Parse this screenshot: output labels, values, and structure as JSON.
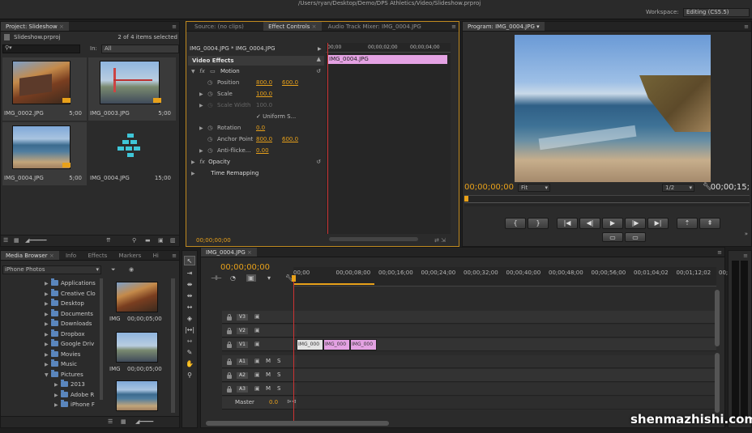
{
  "menubar": {
    "title": "/Users/ryan/Desktop/Demo/DPS Athletics/Video/Slideshow.prproj",
    "workspace_label": "Workspace:",
    "workspace_value": "Editing (CS5.5)"
  },
  "project": {
    "tab": "Project: Slideshow",
    "file": "Slideshow.prproj",
    "count": "2 of 4 items selected",
    "search_placeholder": "",
    "in_label": "In:",
    "in_value": "All",
    "items": [
      {
        "name": "IMG_0002.JPG",
        "duration": "5;00"
      },
      {
        "name": "IMG_0003.JPG",
        "duration": "5;00"
      },
      {
        "name": "IMG_0004.JPG",
        "duration": "5;00"
      },
      {
        "name": "IMG_0004.JPG",
        "duration": "15;00"
      }
    ]
  },
  "effects": {
    "tabs": [
      "Source: (no clips)",
      "Effect Controls",
      "Audio Track Mixer: IMG_0004.JPG"
    ],
    "clip_path": "IMG_0004.JPG * IMG_0004.JPG",
    "section": "Video Effects",
    "motion": "Motion",
    "props": [
      {
        "name": "Position",
        "v1": "800.0",
        "v2": "600.0"
      },
      {
        "name": "Scale",
        "v1": "100.0",
        "v2": ""
      },
      {
        "name": "Scale Width",
        "v1": "100.0",
        "v2": ""
      },
      {
        "name": "Uniform S...",
        "v1": "",
        "v2": ""
      },
      {
        "name": "Rotation",
        "v1": "0.0",
        "v2": ""
      },
      {
        "name": "Anchor Point",
        "v1": "800.0",
        "v2": "600.0"
      },
      {
        "name": "Anti-flicke...",
        "v1": "0.00",
        "v2": ""
      }
    ],
    "opacity": "Opacity",
    "time_remap": "Time Remapping",
    "ruler": [
      "00;00",
      "00;00;02;00",
      "00;00;04;00"
    ],
    "clip_label": "IMG_0004.JPG",
    "timecode": "00;00;00;00"
  },
  "program": {
    "tab": "Program: IMG_0004.JPG",
    "timecode_in": "00;00;00;00",
    "fit": "Fit",
    "resolution": "1/2",
    "timecode_out": "00;00;15;"
  },
  "media": {
    "tabs": [
      "Media Browser",
      "Info",
      "Effects",
      "Markers",
      "Hi"
    ],
    "location": "iPhone Photos",
    "folders": [
      {
        "name": "Applications",
        "indent": 1
      },
      {
        "name": "Creative Clo",
        "indent": 1
      },
      {
        "name": "Desktop",
        "indent": 1
      },
      {
        "name": "Documents",
        "indent": 1
      },
      {
        "name": "Downloads",
        "indent": 1
      },
      {
        "name": "Dropbox",
        "indent": 1
      },
      {
        "name": "Google Driv",
        "indent": 1
      },
      {
        "name": "Movies",
        "indent": 1
      },
      {
        "name": "Music",
        "indent": 1
      },
      {
        "name": "Pictures",
        "indent": 1
      },
      {
        "name": "2013",
        "indent": 2
      },
      {
        "name": "Adobe R",
        "indent": 2
      },
      {
        "name": "iPhone F",
        "indent": 2
      }
    ],
    "thumb_labels": [
      {
        "name": "IMG",
        "duration": "00;00;05;00"
      },
      {
        "name": "IMG",
        "duration": "00;00;05;00"
      }
    ]
  },
  "timeline": {
    "tab": "IMG_0004.JPG",
    "timecode": "00;00;00;00",
    "ruler": [
      "00;00",
      "00;00;08;00",
      "00;00;16;00",
      "00;00;24;00",
      "00;00;32;00",
      "00;00;40;00",
      "00;00;48;00",
      "00;00;56;00",
      "00;01;04;02",
      "00;01;12;02",
      "00;0"
    ],
    "video_tracks": [
      "V3",
      "V2",
      "V1"
    ],
    "audio_tracks": [
      "A1",
      "A2",
      "A3"
    ],
    "master_label": "Master",
    "master_value": "0.0",
    "m_label": "M",
    "s_label": "S",
    "clips": [
      "IMG_000",
      "IMG_000",
      "IMG_000"
    ]
  },
  "watermark": "shenmazhishi.com",
  "colors": {
    "accent": "#e8a11a",
    "clip_pink": "#e4a2e3",
    "clip_white": "#e3e3e3",
    "timecode_blue": "#5fa0e6"
  }
}
